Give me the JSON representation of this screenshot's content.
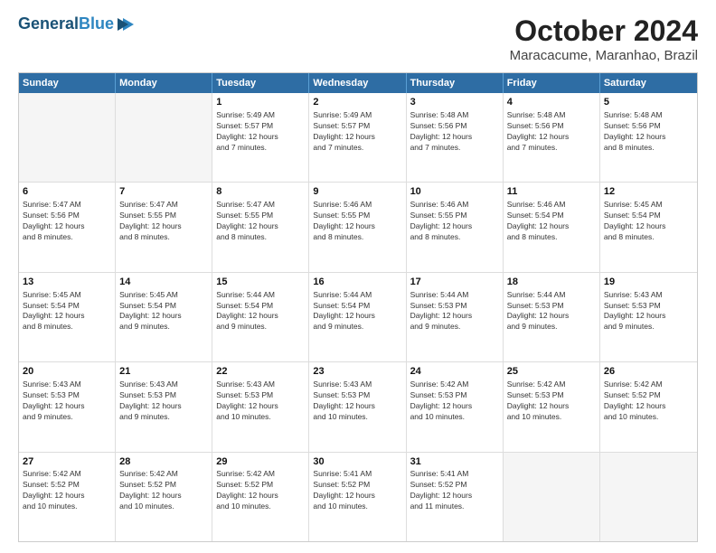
{
  "logo": {
    "line1": "General",
    "line2": "Blue"
  },
  "title": "October 2024",
  "subtitle": "Maracacume, Maranhao, Brazil",
  "header": {
    "days": [
      "Sunday",
      "Monday",
      "Tuesday",
      "Wednesday",
      "Thursday",
      "Friday",
      "Saturday"
    ]
  },
  "weeks": [
    {
      "cells": [
        {
          "day": "",
          "empty": true
        },
        {
          "day": "",
          "empty": true
        },
        {
          "day": "1",
          "info": "Sunrise: 5:49 AM\nSunset: 5:57 PM\nDaylight: 12 hours\nand 7 minutes."
        },
        {
          "day": "2",
          "info": "Sunrise: 5:49 AM\nSunset: 5:57 PM\nDaylight: 12 hours\nand 7 minutes."
        },
        {
          "day": "3",
          "info": "Sunrise: 5:48 AM\nSunset: 5:56 PM\nDaylight: 12 hours\nand 7 minutes."
        },
        {
          "day": "4",
          "info": "Sunrise: 5:48 AM\nSunset: 5:56 PM\nDaylight: 12 hours\nand 7 minutes."
        },
        {
          "day": "5",
          "info": "Sunrise: 5:48 AM\nSunset: 5:56 PM\nDaylight: 12 hours\nand 8 minutes."
        }
      ]
    },
    {
      "cells": [
        {
          "day": "6",
          "info": "Sunrise: 5:47 AM\nSunset: 5:56 PM\nDaylight: 12 hours\nand 8 minutes."
        },
        {
          "day": "7",
          "info": "Sunrise: 5:47 AM\nSunset: 5:55 PM\nDaylight: 12 hours\nand 8 minutes."
        },
        {
          "day": "8",
          "info": "Sunrise: 5:47 AM\nSunset: 5:55 PM\nDaylight: 12 hours\nand 8 minutes."
        },
        {
          "day": "9",
          "info": "Sunrise: 5:46 AM\nSunset: 5:55 PM\nDaylight: 12 hours\nand 8 minutes."
        },
        {
          "day": "10",
          "info": "Sunrise: 5:46 AM\nSunset: 5:55 PM\nDaylight: 12 hours\nand 8 minutes."
        },
        {
          "day": "11",
          "info": "Sunrise: 5:46 AM\nSunset: 5:54 PM\nDaylight: 12 hours\nand 8 minutes."
        },
        {
          "day": "12",
          "info": "Sunrise: 5:45 AM\nSunset: 5:54 PM\nDaylight: 12 hours\nand 8 minutes."
        }
      ]
    },
    {
      "cells": [
        {
          "day": "13",
          "info": "Sunrise: 5:45 AM\nSunset: 5:54 PM\nDaylight: 12 hours\nand 8 minutes."
        },
        {
          "day": "14",
          "info": "Sunrise: 5:45 AM\nSunset: 5:54 PM\nDaylight: 12 hours\nand 9 minutes."
        },
        {
          "day": "15",
          "info": "Sunrise: 5:44 AM\nSunset: 5:54 PM\nDaylight: 12 hours\nand 9 minutes."
        },
        {
          "day": "16",
          "info": "Sunrise: 5:44 AM\nSunset: 5:54 PM\nDaylight: 12 hours\nand 9 minutes."
        },
        {
          "day": "17",
          "info": "Sunrise: 5:44 AM\nSunset: 5:53 PM\nDaylight: 12 hours\nand 9 minutes."
        },
        {
          "day": "18",
          "info": "Sunrise: 5:44 AM\nSunset: 5:53 PM\nDaylight: 12 hours\nand 9 minutes."
        },
        {
          "day": "19",
          "info": "Sunrise: 5:43 AM\nSunset: 5:53 PM\nDaylight: 12 hours\nand 9 minutes."
        }
      ]
    },
    {
      "cells": [
        {
          "day": "20",
          "info": "Sunrise: 5:43 AM\nSunset: 5:53 PM\nDaylight: 12 hours\nand 9 minutes."
        },
        {
          "day": "21",
          "info": "Sunrise: 5:43 AM\nSunset: 5:53 PM\nDaylight: 12 hours\nand 9 minutes."
        },
        {
          "day": "22",
          "info": "Sunrise: 5:43 AM\nSunset: 5:53 PM\nDaylight: 12 hours\nand 10 minutes."
        },
        {
          "day": "23",
          "info": "Sunrise: 5:43 AM\nSunset: 5:53 PM\nDaylight: 12 hours\nand 10 minutes."
        },
        {
          "day": "24",
          "info": "Sunrise: 5:42 AM\nSunset: 5:53 PM\nDaylight: 12 hours\nand 10 minutes."
        },
        {
          "day": "25",
          "info": "Sunrise: 5:42 AM\nSunset: 5:53 PM\nDaylight: 12 hours\nand 10 minutes."
        },
        {
          "day": "26",
          "info": "Sunrise: 5:42 AM\nSunset: 5:52 PM\nDaylight: 12 hours\nand 10 minutes."
        }
      ]
    },
    {
      "cells": [
        {
          "day": "27",
          "info": "Sunrise: 5:42 AM\nSunset: 5:52 PM\nDaylight: 12 hours\nand 10 minutes."
        },
        {
          "day": "28",
          "info": "Sunrise: 5:42 AM\nSunset: 5:52 PM\nDaylight: 12 hours\nand 10 minutes."
        },
        {
          "day": "29",
          "info": "Sunrise: 5:42 AM\nSunset: 5:52 PM\nDaylight: 12 hours\nand 10 minutes."
        },
        {
          "day": "30",
          "info": "Sunrise: 5:41 AM\nSunset: 5:52 PM\nDaylight: 12 hours\nand 10 minutes."
        },
        {
          "day": "31",
          "info": "Sunrise: 5:41 AM\nSunset: 5:52 PM\nDaylight: 12 hours\nand 11 minutes."
        },
        {
          "day": "",
          "empty": true
        },
        {
          "day": "",
          "empty": true
        }
      ]
    }
  ]
}
